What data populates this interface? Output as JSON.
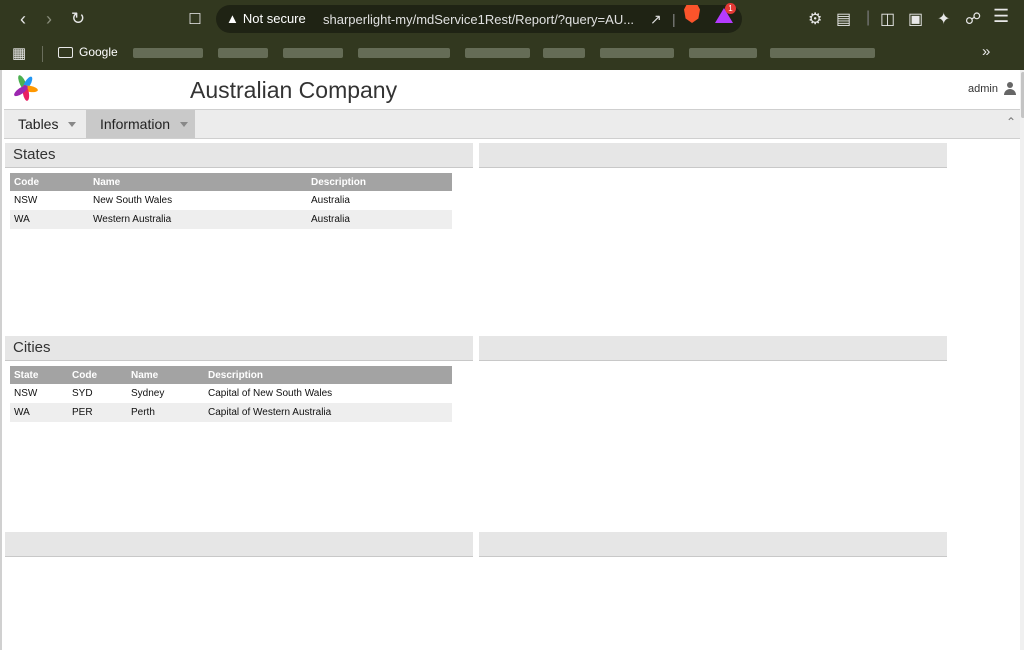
{
  "browser": {
    "security_label": "Not secure",
    "url": "sharperlight-my/mdService1Rest/Report/?query=AU...",
    "rewards_badge": "1",
    "bookmarks": {
      "first_label": "Google"
    }
  },
  "app": {
    "title": "Australian Company",
    "user": "admin"
  },
  "menu": {
    "items": [
      {
        "label": "Tables"
      },
      {
        "label": "Information"
      }
    ]
  },
  "states": {
    "title": "States",
    "columns": [
      "Code",
      "Name",
      "Description"
    ],
    "rows": [
      [
        "NSW",
        "New South Wales",
        "Australia"
      ],
      [
        "WA",
        "Western Australia",
        "Australia"
      ]
    ]
  },
  "cities": {
    "title": "Cities",
    "columns": [
      "State",
      "Code",
      "Name",
      "Description"
    ],
    "rows": [
      [
        "NSW",
        "SYD",
        "Sydney",
        "Capital of New South Wales"
      ],
      [
        "WA",
        "PER",
        "Perth",
        "Capital of Western Australia"
      ]
    ]
  },
  "colors": {
    "chrome": "#32381f",
    "table_header": "#a3a3a3",
    "panel_header": "#e6e6e6"
  }
}
